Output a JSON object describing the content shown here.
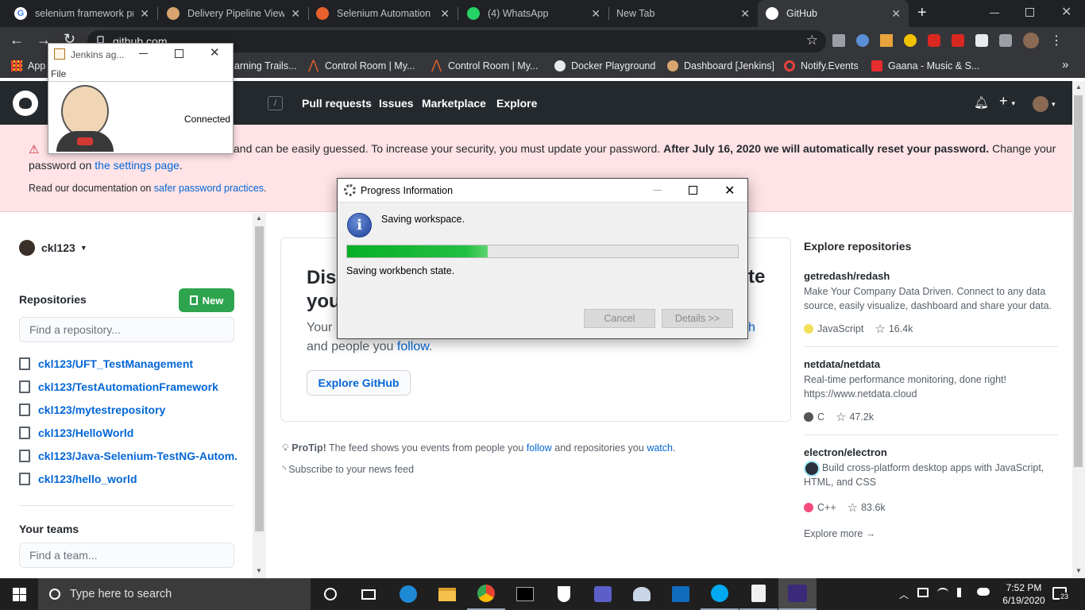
{
  "browser": {
    "tabs": [
      {
        "title": "selenium framework pr",
        "fav_color": "#ffffff"
      },
      {
        "title": "Delivery Pipeline View [",
        "fav_color": "#d9a46f"
      },
      {
        "title": "Selenium Automation F",
        "fav_color": "#e8602c"
      },
      {
        "title": "(4) WhatsApp",
        "fav_color": "#25d366"
      },
      {
        "title": "New Tab",
        "fav_color": ""
      },
      {
        "title": "GitHub",
        "fav_color": "#ffffff"
      }
    ],
    "new_tab_symbol": "+",
    "url": "github.com",
    "bookmarks": [
      {
        "label": "App"
      },
      {
        "label": "arning Trails..."
      },
      {
        "label": "Control Room | My..."
      },
      {
        "label": "Control Room | My..."
      },
      {
        "label": "Docker Playground"
      },
      {
        "label": "Dashboard [Jenkins]"
      },
      {
        "label": "Notify.Events"
      },
      {
        "label": "Gaana - Music & S..."
      }
    ],
    "bookmarks_more": "»"
  },
  "github": {
    "search_slash": "/",
    "nav": [
      "Pull requests",
      "Issues",
      "Marketplace",
      "Explore"
    ],
    "flash": {
      "line1_prefix": "and can be easily guessed. To increase your security, you must update your password.",
      "line1_bold": "After July 16, 2020 we will automatically reset your password.",
      "line1_suffix": "Change your",
      "line2_prefix": "password on",
      "line2_link": "the settings page",
      "line2_suffix": ".",
      "docs_prefix": "Read our documentation on",
      "docs_link": "safer password practices",
      "docs_suffix": "."
    },
    "sidebar": {
      "username": "ckl123",
      "repositories_heading": "Repositories",
      "new_button": "New",
      "find_repo_placeholder": "Find a repository...",
      "repos": [
        "ckl123/UFT_TestManagement",
        "ckl123/TestAutomationFramework",
        "ckl123/mytestrepository",
        "ckl123/HelloWorld",
        "ckl123/Java-Selenium-TestNG-Autom...",
        "ckl123/hello_world"
      ],
      "teams_heading": "Your teams",
      "find_team_placeholder": "Find a team..."
    },
    "discover": {
      "heading_left1": "Disc",
      "heading_right1": "te",
      "heading_left2": "you",
      "text_left": "Your",
      "text_right_link": "h",
      "line2_prefix": "and people you",
      "line2_link": "follow",
      "line2_suffix": ".",
      "explore_button": "Explore GitHub"
    },
    "protip": {
      "bold": "ProTip!",
      "text1": "The feed shows you events from people you",
      "link1": "follow",
      "text2": "and repositories you",
      "link2": "watch",
      "text3": ".",
      "subscribe": "Subscribe to your news feed"
    },
    "explore": {
      "heading": "Explore repositories",
      "repos": [
        {
          "name": "getredash/redash",
          "desc": "Make Your Company Data Driven. Connect to any data source, easily visualize, dashboard and share your data.",
          "language": "JavaScript",
          "lang_color": "#f1e05a",
          "stars": "16.4k"
        },
        {
          "name": "netdata/netdata",
          "desc": "Real-time performance monitoring, done right! https://www.netdata.cloud",
          "language": "C",
          "lang_color": "#555555",
          "stars": "47.2k"
        },
        {
          "name": "electron/electron",
          "desc": "Build cross-platform desktop apps with JavaScript, HTML, and CSS",
          "language": "C++",
          "lang_color": "#f34b7d",
          "stars": "83.6k"
        }
      ],
      "more": "Explore more →"
    }
  },
  "jenkins_window": {
    "title": "Jenkins ag...",
    "menu": "File",
    "status": "Connected"
  },
  "progress_dialog": {
    "title": "Progress Information",
    "message": "Saving workspace.",
    "progress": 0.36,
    "subtask": "Saving workbench state.",
    "cancel_button": "Cancel",
    "details_button": "Details >>"
  },
  "taskbar": {
    "search_placeholder": "Type here to search",
    "time": "7:52 PM",
    "date": "6/19/2020",
    "notification_count": "23"
  }
}
